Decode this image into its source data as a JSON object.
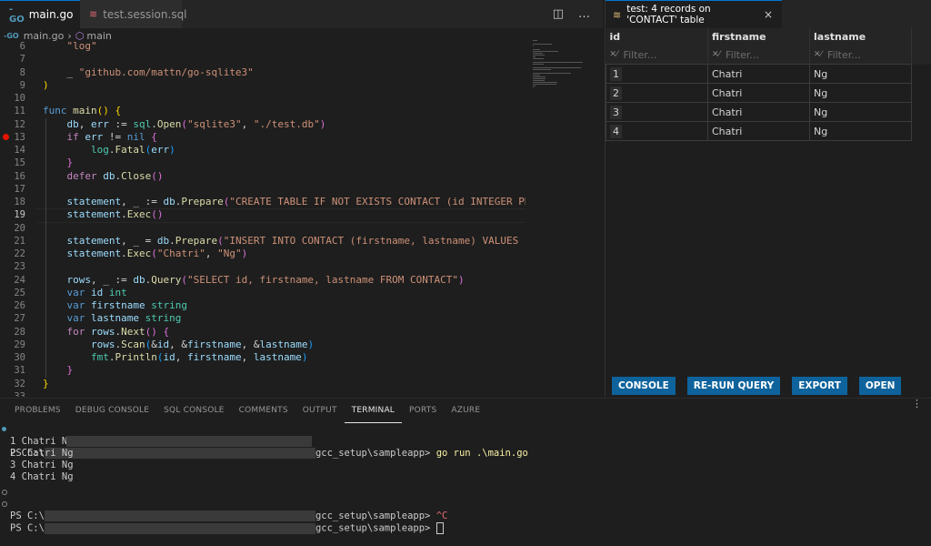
{
  "editor": {
    "tabs": [
      {
        "label": "main.go",
        "icon": "go-file-icon",
        "close": "×"
      },
      {
        "label": "test.session.sql",
        "icon": "database-icon"
      }
    ],
    "actions": {
      "split": "◫",
      "more": "…"
    },
    "breadcrumb": {
      "file": "main.go",
      "symbol": "main"
    },
    "icons": {
      "go": "-GO",
      "db": "≋",
      "cube": "⬡"
    },
    "lines": [
      {
        "n": "6",
        "tokens": [
          [
            "s",
            "    \"log\""
          ]
        ]
      },
      {
        "n": "7",
        "tokens": []
      },
      {
        "n": "8",
        "tokens": [
          [
            "p",
            "    _ "
          ],
          [
            "s",
            "\"github.com/mattn/go-sqlite3\""
          ]
        ]
      },
      {
        "n": "9",
        "tokens": [
          [
            "b1",
            ")"
          ]
        ]
      },
      {
        "n": "10",
        "tokens": []
      },
      {
        "n": "11",
        "tokens": [
          [
            "k",
            "func "
          ],
          [
            "f",
            "main"
          ],
          [
            "b1",
            "()"
          ],
          [
            "p",
            " "
          ],
          [
            "b1",
            "{"
          ]
        ]
      },
      {
        "n": "12",
        "tokens": [
          [
            "p",
            "    "
          ],
          [
            "v",
            "db"
          ],
          [
            "p",
            ", "
          ],
          [
            "v",
            "err"
          ],
          [
            "p",
            " := "
          ],
          [
            "pk",
            "sql"
          ],
          [
            "p",
            "."
          ],
          [
            "f",
            "Open"
          ],
          [
            "b2",
            "("
          ],
          [
            "s",
            "\"sqlite3\""
          ],
          [
            "p",
            ", "
          ],
          [
            "s",
            "\"./test.db\""
          ],
          [
            "b2",
            ")"
          ]
        ]
      },
      {
        "n": "13",
        "tokens": [
          [
            "p",
            "    "
          ],
          [
            "c",
            "if "
          ],
          [
            "v",
            "err"
          ],
          [
            "p",
            " != "
          ],
          [
            "k",
            "nil"
          ],
          [
            "p",
            " "
          ],
          [
            "b2",
            "{"
          ]
        ],
        "breakpoint": true
      },
      {
        "n": "14",
        "tokens": [
          [
            "p",
            "        "
          ],
          [
            "pk",
            "log"
          ],
          [
            "p",
            "."
          ],
          [
            "f",
            "Fatal"
          ],
          [
            "b3",
            "("
          ],
          [
            "v",
            "err"
          ],
          [
            "b3",
            ")"
          ]
        ]
      },
      {
        "n": "15",
        "tokens": [
          [
            "p",
            "    "
          ],
          [
            "b2",
            "}"
          ]
        ]
      },
      {
        "n": "16",
        "tokens": [
          [
            "p",
            "    "
          ],
          [
            "c",
            "defer "
          ],
          [
            "v",
            "db"
          ],
          [
            "p",
            "."
          ],
          [
            "f",
            "Close"
          ],
          [
            "b2",
            "()"
          ]
        ]
      },
      {
        "n": "17",
        "tokens": []
      },
      {
        "n": "18",
        "tokens": [
          [
            "p",
            "    "
          ],
          [
            "v",
            "statement"
          ],
          [
            "p",
            ", _ := "
          ],
          [
            "v",
            "db"
          ],
          [
            "p",
            "."
          ],
          [
            "f",
            "Prepare"
          ],
          [
            "b2",
            "("
          ],
          [
            "s",
            "\"CREATE TABLE IF NOT EXISTS CONTACT (id INTEGER PRIMARY KEY,"
          ]
        ]
      },
      {
        "n": "19",
        "tokens": [
          [
            "p",
            "    "
          ],
          [
            "v",
            "statement"
          ],
          [
            "p",
            "."
          ],
          [
            "f",
            "Exec"
          ],
          [
            "b2",
            "()"
          ]
        ],
        "current": true
      },
      {
        "n": "20",
        "tokens": []
      },
      {
        "n": "21",
        "tokens": [
          [
            "p",
            "    "
          ],
          [
            "v",
            "statement"
          ],
          [
            "p",
            ", _ = "
          ],
          [
            "v",
            "db"
          ],
          [
            "p",
            "."
          ],
          [
            "f",
            "Prepare"
          ],
          [
            "b2",
            "("
          ],
          [
            "s",
            "\"INSERT INTO CONTACT (firstname, lastname) VALUES (?, ?)\""
          ],
          [
            "b2",
            ")"
          ]
        ]
      },
      {
        "n": "22",
        "tokens": [
          [
            "p",
            "    "
          ],
          [
            "v",
            "statement"
          ],
          [
            "p",
            "."
          ],
          [
            "f",
            "Exec"
          ],
          [
            "b2",
            "("
          ],
          [
            "s",
            "\"Chatri\""
          ],
          [
            "p",
            ", "
          ],
          [
            "s",
            "\"Ng\""
          ],
          [
            "b2",
            ")"
          ]
        ]
      },
      {
        "n": "23",
        "tokens": []
      },
      {
        "n": "24",
        "tokens": [
          [
            "p",
            "    "
          ],
          [
            "v",
            "rows"
          ],
          [
            "p",
            ", _ := "
          ],
          [
            "v",
            "db"
          ],
          [
            "p",
            "."
          ],
          [
            "f",
            "Query"
          ],
          [
            "b2",
            "("
          ],
          [
            "s",
            "\"SELECT id, firstname, lastname FROM CONTACT\""
          ],
          [
            "b2",
            ")"
          ]
        ]
      },
      {
        "n": "25",
        "tokens": [
          [
            "p",
            "    "
          ],
          [
            "k",
            "var "
          ],
          [
            "v",
            "id "
          ],
          [
            "t",
            "int"
          ]
        ]
      },
      {
        "n": "26",
        "tokens": [
          [
            "p",
            "    "
          ],
          [
            "k",
            "var "
          ],
          [
            "v",
            "firstname "
          ],
          [
            "t",
            "string"
          ]
        ]
      },
      {
        "n": "27",
        "tokens": [
          [
            "p",
            "    "
          ],
          [
            "k",
            "var "
          ],
          [
            "v",
            "lastname "
          ],
          [
            "t",
            "string"
          ]
        ]
      },
      {
        "n": "28",
        "tokens": [
          [
            "p",
            "    "
          ],
          [
            "c",
            "for "
          ],
          [
            "v",
            "rows"
          ],
          [
            "p",
            "."
          ],
          [
            "f",
            "Next"
          ],
          [
            "b2",
            "()"
          ],
          [
            "p",
            " "
          ],
          [
            "b2",
            "{"
          ]
        ]
      },
      {
        "n": "29",
        "tokens": [
          [
            "p",
            "        "
          ],
          [
            "v",
            "rows"
          ],
          [
            "p",
            "."
          ],
          [
            "f",
            "Scan"
          ],
          [
            "b3",
            "("
          ],
          [
            "p",
            "&"
          ],
          [
            "v",
            "id"
          ],
          [
            "p",
            ", &"
          ],
          [
            "v",
            "firstname"
          ],
          [
            "p",
            ", &"
          ],
          [
            "v",
            "lastname"
          ],
          [
            "b3",
            ")"
          ]
        ]
      },
      {
        "n": "30",
        "tokens": [
          [
            "p",
            "        "
          ],
          [
            "pk",
            "fmt"
          ],
          [
            "p",
            "."
          ],
          [
            "f",
            "Println"
          ],
          [
            "b3",
            "("
          ],
          [
            "v",
            "id"
          ],
          [
            "p",
            ", "
          ],
          [
            "v",
            "firstname"
          ],
          [
            "p",
            ", "
          ],
          [
            "v",
            "lastname"
          ],
          [
            "b3",
            ")"
          ]
        ]
      },
      {
        "n": "31",
        "tokens": [
          [
            "p",
            "    "
          ],
          [
            "b2",
            "}"
          ]
        ]
      },
      {
        "n": "32",
        "tokens": [
          [
            "b1",
            "}"
          ]
        ]
      },
      {
        "n": "33",
        "tokens": []
      }
    ]
  },
  "results": {
    "tab_label": "test: 4 records on 'CONTACT' table",
    "tab_close": "×",
    "columns": [
      "id",
      "firstname",
      "lastname"
    ],
    "filter_placeholder": "Filter...",
    "filter_icon": "✕⁄",
    "rows": [
      [
        "1",
        "Chatri",
        "Ng"
      ],
      [
        "2",
        "Chatri",
        "Ng"
      ],
      [
        "3",
        "Chatri",
        "Ng"
      ],
      [
        "4",
        "Chatri",
        "Ng"
      ]
    ],
    "buttons": [
      "CONSOLE",
      "RE-RUN QUERY",
      "EXPORT",
      "OPEN"
    ]
  },
  "panel": {
    "tabs": [
      "PROBLEMS",
      "DEBUG CONSOLE",
      "SQL CONSOLE",
      "COMMENTS",
      "OUTPUT",
      "TERMINAL",
      "PORTS",
      "AZURE"
    ],
    "active_tab": "TERMINAL",
    "more": "⋮",
    "terminal": {
      "prompt_prefix": "PS C:\\",
      "path_suffix": "gcc_setup\\sampleapp> ",
      "command": "go run .\\main.go",
      "output": [
        "1 Chatri Ng",
        "2 Chatri Ng",
        "3 Chatri Ng",
        "4 Chatri Ng"
      ],
      "interrupt": "^C"
    }
  }
}
